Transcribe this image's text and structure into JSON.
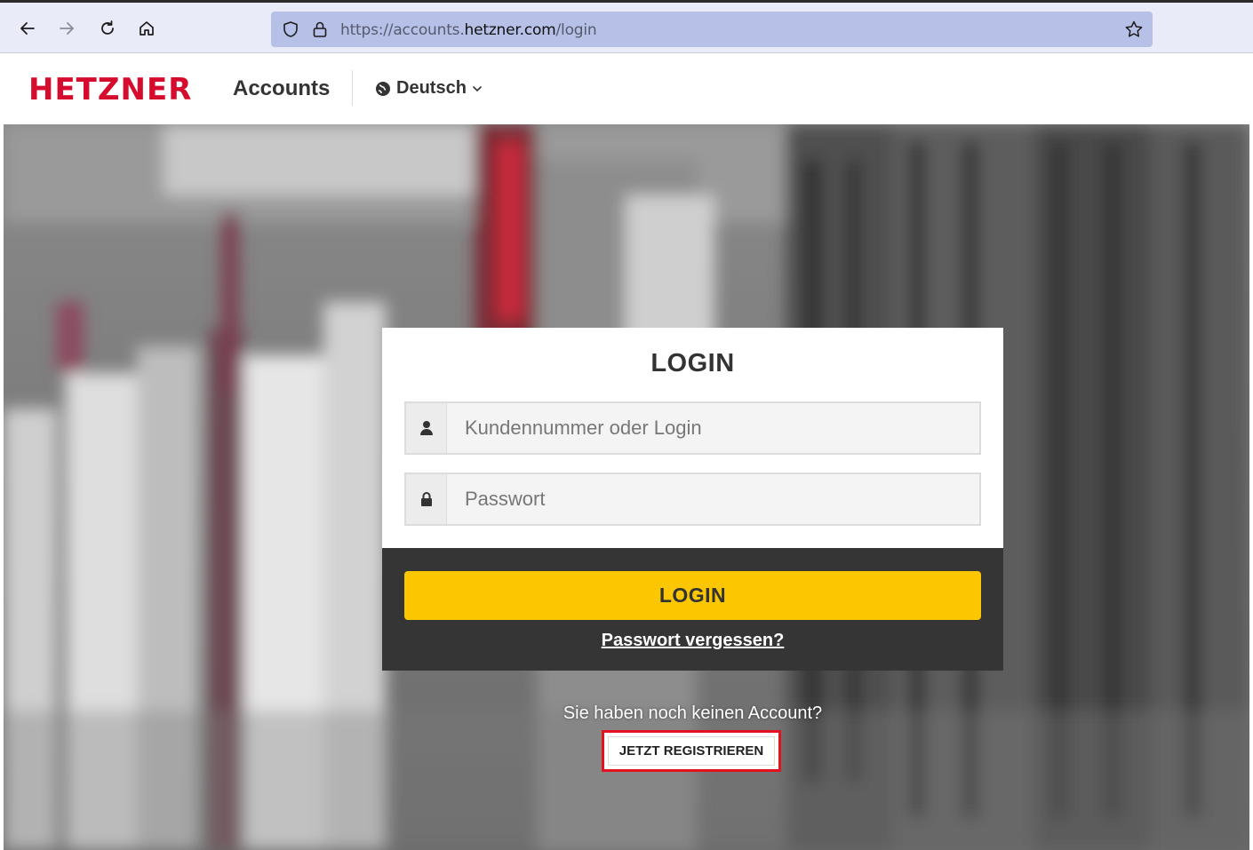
{
  "browser": {
    "url_prefix": "https://accounts.",
    "url_host": "hetzner.com",
    "url_path": "/login"
  },
  "header": {
    "logo_text": "HETZNER",
    "app_title": "Accounts",
    "language": "Deutsch"
  },
  "login": {
    "title": "LOGIN",
    "username_placeholder": "Kundennummer oder Login",
    "password_placeholder": "Passwort",
    "login_button": "LOGIN",
    "forgot_link": "Passwort vergessen?"
  },
  "register": {
    "prompt": "Sie haben noch keinen Account?",
    "button": "JETZT REGISTRIEREN"
  },
  "colors": {
    "brand_red": "#d50c2d",
    "login_yellow": "#fcc600",
    "highlight_red": "#e4121f"
  }
}
